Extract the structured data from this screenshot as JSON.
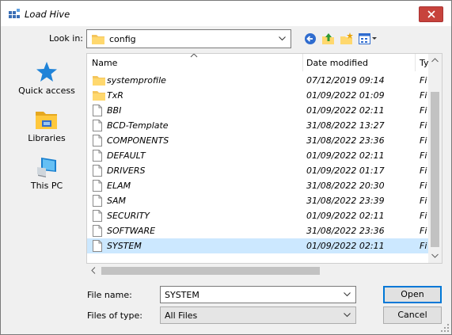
{
  "window": {
    "title": "Load Hive"
  },
  "toolbar": {
    "lookin_label": "Look in:",
    "lookin_value": "config",
    "icons": [
      "back-icon",
      "up-folder-icon",
      "new-folder-icon",
      "view-menu-icon"
    ]
  },
  "places": [
    {
      "label": "Quick access",
      "icon": "star-icon"
    },
    {
      "label": "Libraries",
      "icon": "libraries-icon"
    },
    {
      "label": "This PC",
      "icon": "computer-icon"
    }
  ],
  "columns": {
    "name": "Name",
    "date": "Date modified",
    "type": "Ty"
  },
  "files": [
    {
      "name": "systemprofile",
      "date": "07/12/2019 09:14",
      "type": "Fi",
      "kind": "folder"
    },
    {
      "name": "TxR",
      "date": "01/09/2022 01:09",
      "type": "Fi",
      "kind": "folder"
    },
    {
      "name": "BBI",
      "date": "01/09/2022 02:11",
      "type": "Fi",
      "kind": "file"
    },
    {
      "name": "BCD-Template",
      "date": "31/08/2022 13:27",
      "type": "Fi",
      "kind": "file"
    },
    {
      "name": "COMPONENTS",
      "date": "31/08/2022 23:36",
      "type": "Fi",
      "kind": "file"
    },
    {
      "name": "DEFAULT",
      "date": "01/09/2022 02:11",
      "type": "Fi",
      "kind": "file"
    },
    {
      "name": "DRIVERS",
      "date": "01/09/2022 01:17",
      "type": "Fi",
      "kind": "file"
    },
    {
      "name": "ELAM",
      "date": "31/08/2022 20:30",
      "type": "Fi",
      "kind": "file"
    },
    {
      "name": "SAM",
      "date": "31/08/2022 23:39",
      "type": "Fi",
      "kind": "file"
    },
    {
      "name": "SECURITY",
      "date": "01/09/2022 02:11",
      "type": "Fi",
      "kind": "file"
    },
    {
      "name": "SOFTWARE",
      "date": "31/08/2022 23:36",
      "type": "Fi",
      "kind": "file"
    },
    {
      "name": "SYSTEM",
      "date": "01/09/2022 02:11",
      "type": "Fi",
      "kind": "file",
      "selected": true
    }
  ],
  "filename": {
    "label": "File name:",
    "value": "SYSTEM"
  },
  "filetype": {
    "label": "Files of type:",
    "value": "All Files"
  },
  "buttons": {
    "open": "Open",
    "cancel": "Cancel"
  },
  "colors": {
    "selection": "#cce8ff",
    "close": "#c7433c",
    "accent": "#0078d7"
  }
}
